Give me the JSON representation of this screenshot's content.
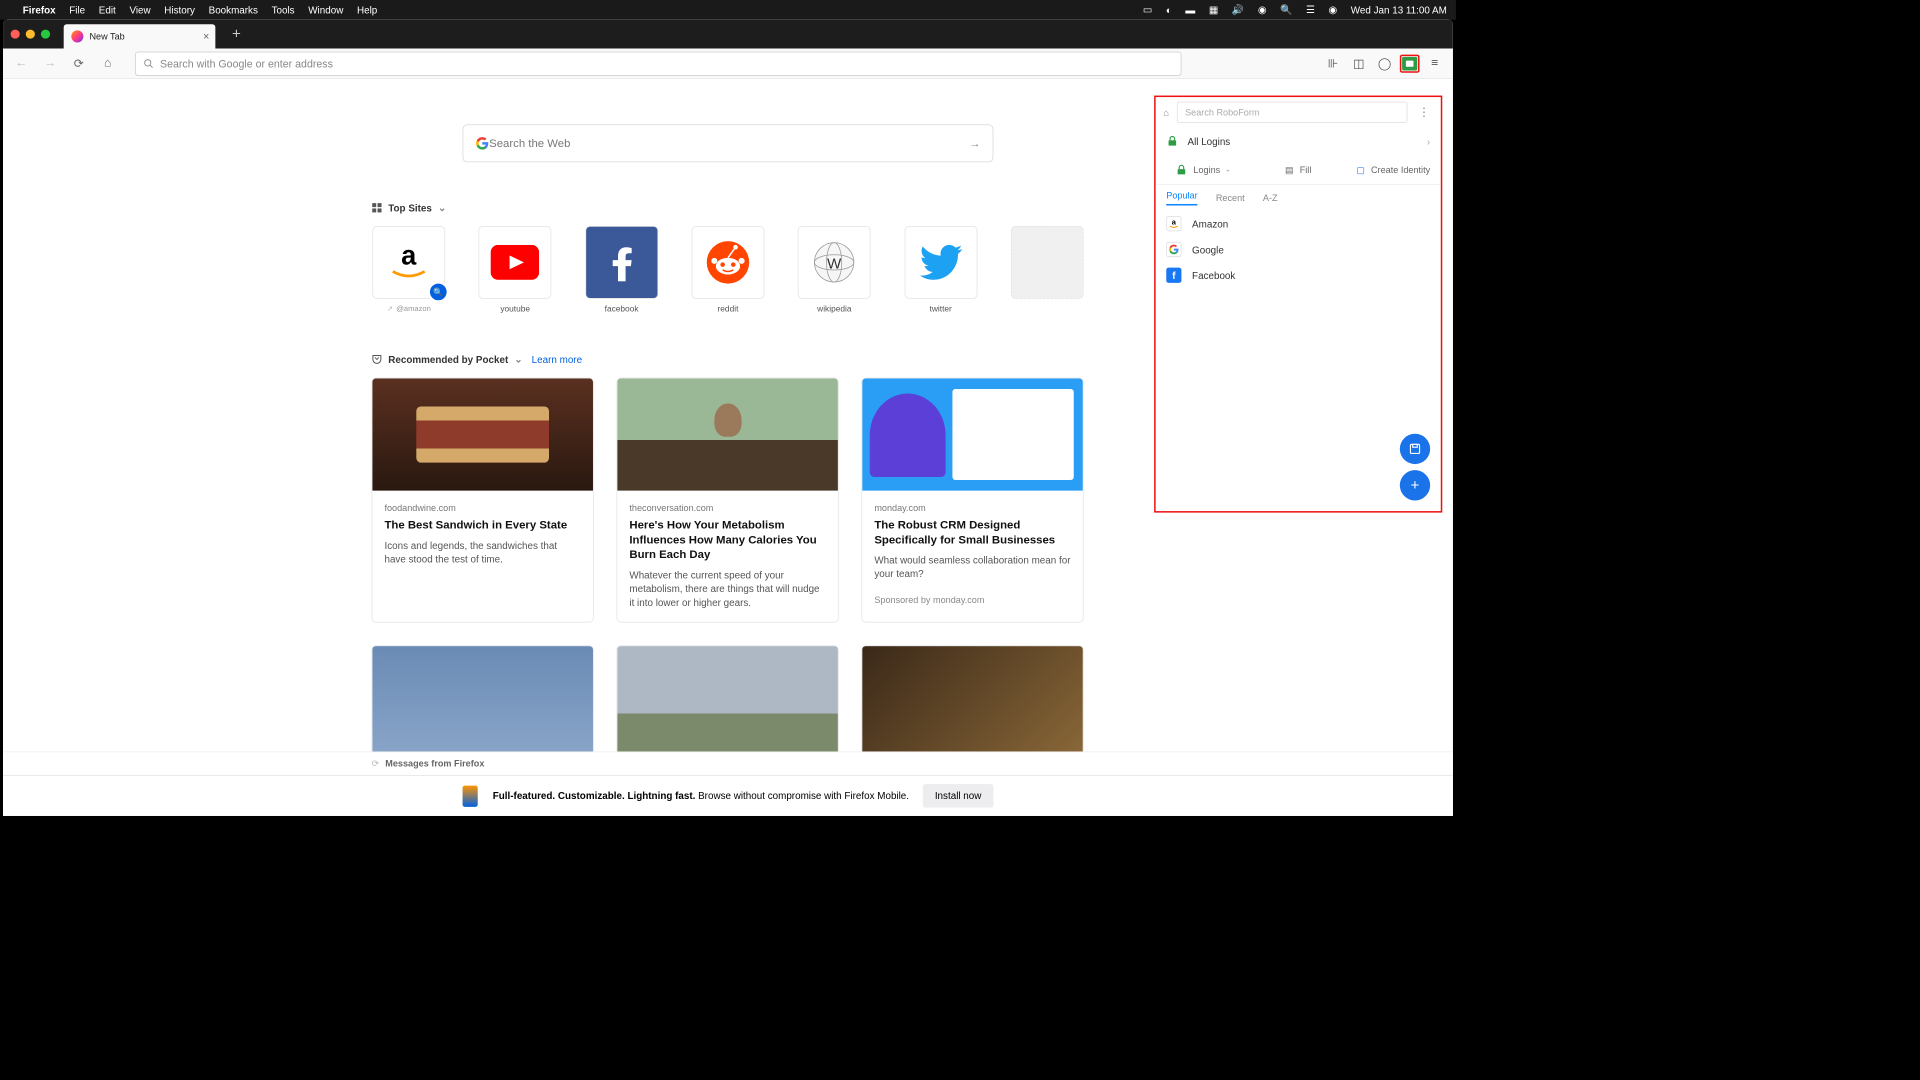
{
  "menubar": {
    "app": "Firefox",
    "items": [
      "File",
      "Edit",
      "View",
      "History",
      "Bookmarks",
      "Tools",
      "Window",
      "Help"
    ],
    "clock": "Wed Jan 13  11:00 AM"
  },
  "tab": {
    "title": "New Tab"
  },
  "urlbar": {
    "placeholder": "Search with Google or enter address"
  },
  "content_search": {
    "placeholder": "Search the Web"
  },
  "top_sites": {
    "heading": "Top Sites",
    "items": [
      {
        "label": "@amazon",
        "sponsored": true
      },
      {
        "label": "youtube"
      },
      {
        "label": "facebook"
      },
      {
        "label": "reddit"
      },
      {
        "label": "wikipedia"
      },
      {
        "label": "twitter"
      },
      {
        "label": ""
      }
    ]
  },
  "pocket": {
    "heading": "Recommended by Pocket",
    "learn": "Learn more",
    "cards": [
      {
        "source": "foodandwine.com",
        "title": "The Best Sandwich in Every State",
        "desc": "Icons and legends, the sandwiches that have stood the test of time.",
        "sponsored": ""
      },
      {
        "source": "theconversation.com",
        "title": "Here's How Your Metabolism Influences How Many Calories You Burn Each Day",
        "desc": "Whatever the current speed of your metabolism, there are things that will nudge it into lower or higher gears.",
        "sponsored": ""
      },
      {
        "source": "monday.com",
        "title": "The Robust CRM Designed Specifically for Small Businesses",
        "desc": "What would seamless collaboration mean for your team?",
        "sponsored": "Sponsored by monday.com"
      }
    ]
  },
  "messages": {
    "label": "Messages from Firefox"
  },
  "promo": {
    "bold": "Full-featured. Customizable. Lightning fast.",
    "text": " Browse without compromise with Firefox Mobile.",
    "button": "Install now"
  },
  "roboform": {
    "search_placeholder": "Search RoboForm",
    "all_logins": "All Logins",
    "actions": {
      "logins": "Logins",
      "fill": "Fill",
      "create": "Create Identity"
    },
    "tabs": [
      "Popular",
      "Recent",
      "A-Z"
    ],
    "items": [
      {
        "name": "Amazon",
        "bg": "#fff",
        "fg": "#000",
        "letter": "a"
      },
      {
        "name": "Google",
        "bg": "#fff",
        "fg": "#4285f4",
        "letter": "G"
      },
      {
        "name": "Facebook",
        "bg": "#1877f2",
        "fg": "#fff",
        "letter": "f"
      }
    ]
  }
}
